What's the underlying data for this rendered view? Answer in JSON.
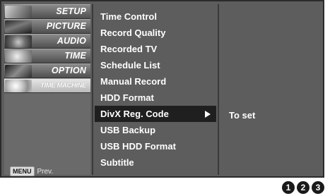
{
  "sidebar": {
    "items": [
      {
        "label": "SETUP",
        "icon": "setup-thumbnail-icon",
        "active": false
      },
      {
        "label": "PICTURE",
        "icon": "picture-thumbnail-icon",
        "active": false
      },
      {
        "label": "AUDIO",
        "icon": "audio-thumbnail-icon",
        "active": false
      },
      {
        "label": "TIME",
        "icon": "time-thumbnail-icon",
        "active": false
      },
      {
        "label": "OPTION",
        "icon": "option-thumbnail-icon",
        "active": false
      },
      {
        "label": "TIME MACHINE",
        "icon": "time-machine-thumbnail-icon",
        "active": true
      }
    ],
    "menu_key": "MENU",
    "menu_hint": "Prev."
  },
  "menu": {
    "items": [
      "Time Control",
      "Record Quality",
      "Recorded TV",
      "Schedule List",
      "Manual Record",
      "HDD Format",
      "DivX Reg. Code",
      "USB Backup",
      "USB HDD Format",
      "Subtitle"
    ],
    "selected_index": 6
  },
  "submenu": {
    "value": "To set"
  },
  "steps": [
    "1",
    "2",
    "3"
  ],
  "colors": {
    "frame": "#5d5d5d",
    "selected_row": "#1f1f1f",
    "text": "#ffffff"
  }
}
